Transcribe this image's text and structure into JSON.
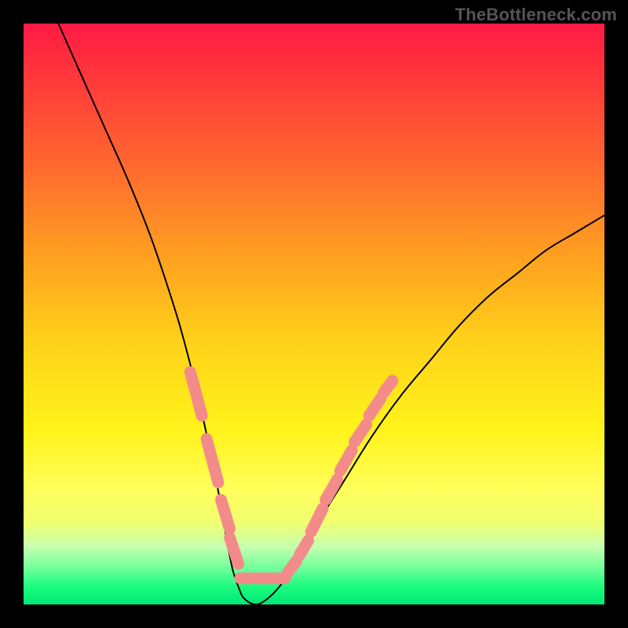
{
  "watermark": "TheBottleneck.com",
  "chart_data": {
    "type": "line",
    "title": "",
    "xlabel": "",
    "ylabel": "",
    "ylim": [
      0,
      100
    ],
    "xlim": [
      0,
      100
    ],
    "series": [
      {
        "name": "bottleneck-curve",
        "x": [
          6,
          10,
          14,
          18,
          22,
          26,
          28,
          30,
          32,
          34,
          35,
          36,
          37,
          38,
          40,
          42,
          44,
          46,
          50,
          55,
          60,
          65,
          70,
          75,
          80,
          85,
          90,
          95,
          100
        ],
        "y": [
          100,
          91,
          82,
          73,
          63,
          51,
          44,
          36,
          27,
          17,
          11,
          6,
          3,
          1,
          0,
          1,
          3,
          6,
          13,
          21,
          29,
          36,
          42,
          48,
          53,
          57,
          61,
          64,
          67
        ]
      }
    ],
    "markers": {
      "name": "highlighted-range",
      "color": "#f48b8b",
      "segments": [
        {
          "x_norm": [
            0.287,
            0.307
          ],
          "y_norm": [
            0.6,
            0.675
          ]
        },
        {
          "x_norm": [
            0.315,
            0.335
          ],
          "y_norm": [
            0.715,
            0.79
          ]
        },
        {
          "x_norm": [
            0.34,
            0.355
          ],
          "y_norm": [
            0.82,
            0.87
          ]
        },
        {
          "x_norm": [
            0.355,
            0.37
          ],
          "y_norm": [
            0.885,
            0.93
          ]
        },
        {
          "x_norm": [
            0.373,
            0.45
          ],
          "y_norm": [
            0.955,
            0.955
          ]
        },
        {
          "x_norm": [
            0.455,
            0.47
          ],
          "y_norm": [
            0.945,
            0.925
          ]
        },
        {
          "x_norm": [
            0.475,
            0.49
          ],
          "y_norm": [
            0.915,
            0.89
          ]
        },
        {
          "x_norm": [
            0.495,
            0.515
          ],
          "y_norm": [
            0.875,
            0.835
          ]
        },
        {
          "x_norm": [
            0.52,
            0.54
          ],
          "y_norm": [
            0.82,
            0.785
          ]
        },
        {
          "x_norm": [
            0.545,
            0.565
          ],
          "y_norm": [
            0.77,
            0.735
          ]
        },
        {
          "x_norm": [
            0.57,
            0.59
          ],
          "y_norm": [
            0.72,
            0.69
          ]
        },
        {
          "x_norm": [
            0.595,
            0.615
          ],
          "y_norm": [
            0.675,
            0.645
          ]
        },
        {
          "x_norm": [
            0.62,
            0.635
          ],
          "y_norm": [
            0.635,
            0.615
          ]
        }
      ]
    }
  }
}
